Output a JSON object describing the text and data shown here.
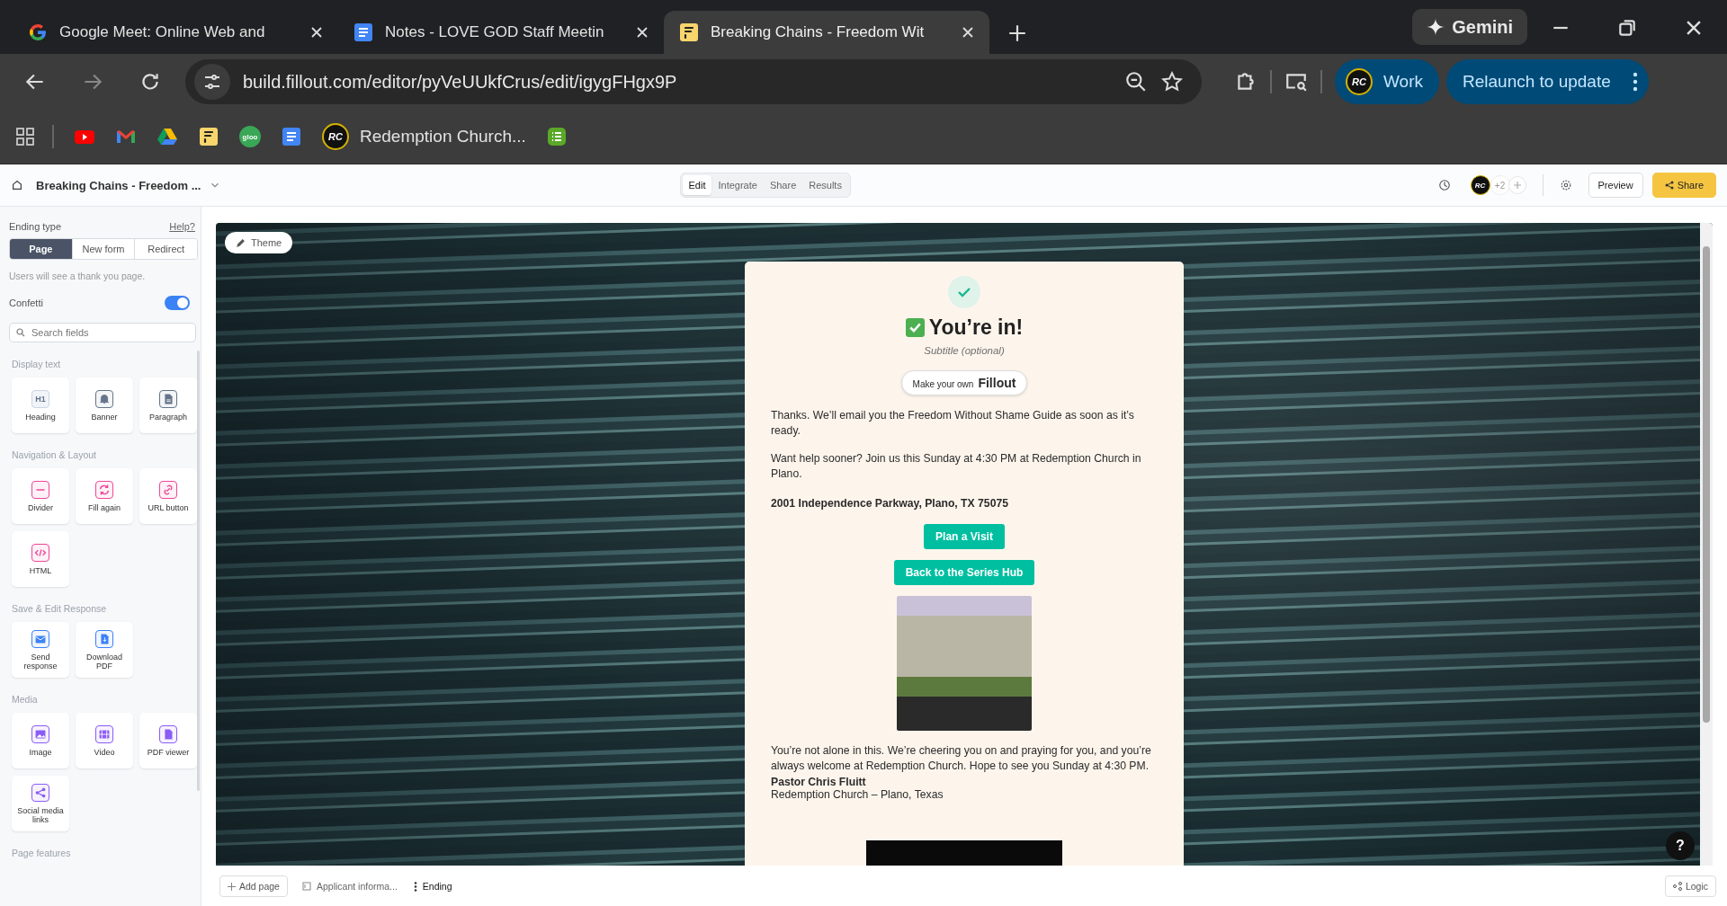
{
  "browser": {
    "tabs": [
      {
        "kind": "google",
        "title": "Google Meet: Online Web and",
        "selected": false
      },
      {
        "kind": "docs",
        "title": "Notes - LOVE GOD Staff Meetin",
        "selected": false
      },
      {
        "kind": "fillout",
        "title": "Breaking Chains - Freedom Wit",
        "selected": true
      }
    ],
    "gemini": "Gemini",
    "url": "build.fillout.com/editor/pyVeUUkfCrus/edit/igygFHgx9P",
    "profile": {
      "glyph": "RC",
      "label": "Work"
    },
    "relaunch": "Relaunch to update",
    "bookmarks": [
      {
        "kind": "apps"
      },
      {
        "kind": "youtube"
      },
      {
        "kind": "gmail"
      },
      {
        "kind": "drive"
      },
      {
        "kind": "fillout"
      },
      {
        "kind": "gloo",
        "glyph": "gloo"
      },
      {
        "kind": "docs"
      },
      {
        "kind": "church",
        "glyph": "RC",
        "label": "Redemption Church..."
      },
      {
        "kind": "sheet"
      }
    ]
  },
  "header": {
    "form_title": "Breaking Chains - Freedom ...",
    "modes": [
      {
        "label": "Edit",
        "selected": true
      },
      {
        "label": "Integrate",
        "selected": false
      },
      {
        "label": "Share",
        "selected": false
      },
      {
        "label": "Results",
        "selected": false
      }
    ],
    "avatar": "RC",
    "collaborators": "+2",
    "preview": "Preview",
    "share": "Share"
  },
  "sidebar": {
    "ending_label": "Ending type",
    "help": "Help?",
    "ending_types": [
      {
        "label": "Page",
        "selected": true
      },
      {
        "label": "New form",
        "selected": false
      },
      {
        "label": "Redirect",
        "selected": false
      }
    ],
    "caption": "Users will see a thank you page.",
    "confetti": {
      "label": "Confetti",
      "on": true
    },
    "search": {
      "placeholder": "Search fields"
    },
    "sections": [
      {
        "title": "Display text",
        "color": "#64748b",
        "items": [
          {
            "kind": "heading",
            "glyph": "H1",
            "label": "Heading"
          },
          {
            "kind": "banner",
            "label": "Banner"
          },
          {
            "kind": "paragraph",
            "label": "Paragraph"
          }
        ]
      },
      {
        "title": "Navigation & Layout",
        "color": "#ec4899",
        "items": [
          {
            "kind": "divider",
            "label": "Divider"
          },
          {
            "kind": "refresh",
            "label": "Fill again"
          },
          {
            "kind": "link",
            "label": "URL button"
          },
          {
            "kind": "code",
            "label": "HTML"
          }
        ]
      },
      {
        "title": "Save & Edit Response",
        "color": "#3b82f6",
        "items": [
          {
            "kind": "mail",
            "label": "Send response"
          },
          {
            "kind": "download",
            "label": "Download PDF"
          }
        ]
      },
      {
        "title": "Media",
        "color": "#8b5cf6",
        "items": [
          {
            "kind": "image",
            "label": "Image"
          },
          {
            "kind": "video",
            "label": "Video"
          },
          {
            "kind": "file",
            "label": "PDF viewer"
          },
          {
            "kind": "share",
            "label": "Social media links"
          }
        ]
      },
      {
        "title": "Page features"
      }
    ]
  },
  "canvas": {
    "theme": "Theme",
    "help_glyph": "?",
    "card": {
      "title": "You’re in!",
      "subtitle": "Subtitle (optional)",
      "badge_prefix": "Make your own",
      "badge_brand": "Fillout",
      "paragraphs": [
        "Thanks. We’ll email you the Freedom Without Shame Guide as soon as it’s ready.",
        "Want help sooner? Join us this Sunday at 4:30 PM at Redemption Church in Plano."
      ],
      "address": "2001 Independence Parkway, Plano, TX 75075",
      "buttons": [
        "Plan a Visit",
        "Back to the Series Hub"
      ],
      "closing": "You’re not alone in this. We’re cheering you on and praying for you, and you’re always welcome at Redemption Church. Hope to see you Sunday at 4:30 PM.",
      "signature": "Pastor Chris Fluitt",
      "church": "Redemption Church – Plano, Texas"
    }
  },
  "footer": {
    "add_page": "Add page",
    "pages": [
      {
        "kind": "info",
        "label": "Applicant informa...",
        "selected": false
      },
      {
        "kind": "ending",
        "label": "Ending",
        "selected": true
      }
    ],
    "logic": "Logic"
  }
}
